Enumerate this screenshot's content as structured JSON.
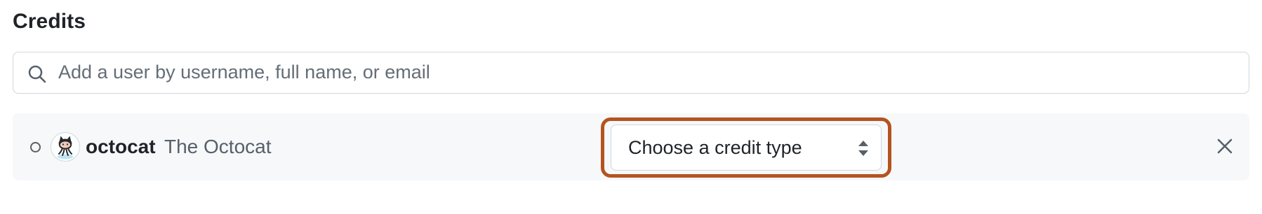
{
  "section": {
    "title": "Credits"
  },
  "search": {
    "placeholder": "Add a user by username, full name, or email",
    "value": "",
    "icon": "search-icon"
  },
  "credit_entry": {
    "username": "octocat",
    "full_name": "The Octocat",
    "avatar_icon": "octocat-avatar",
    "status_icon": "circle-outline-icon",
    "credit_type": {
      "selected_label": "Choose a credit type",
      "icon": "select-arrows-icon"
    },
    "remove_icon": "close-icon"
  },
  "colors": {
    "highlight": "#b5531f",
    "row_background": "#f6f8fa",
    "border": "#d0d7de",
    "muted_text": "#57606a"
  }
}
